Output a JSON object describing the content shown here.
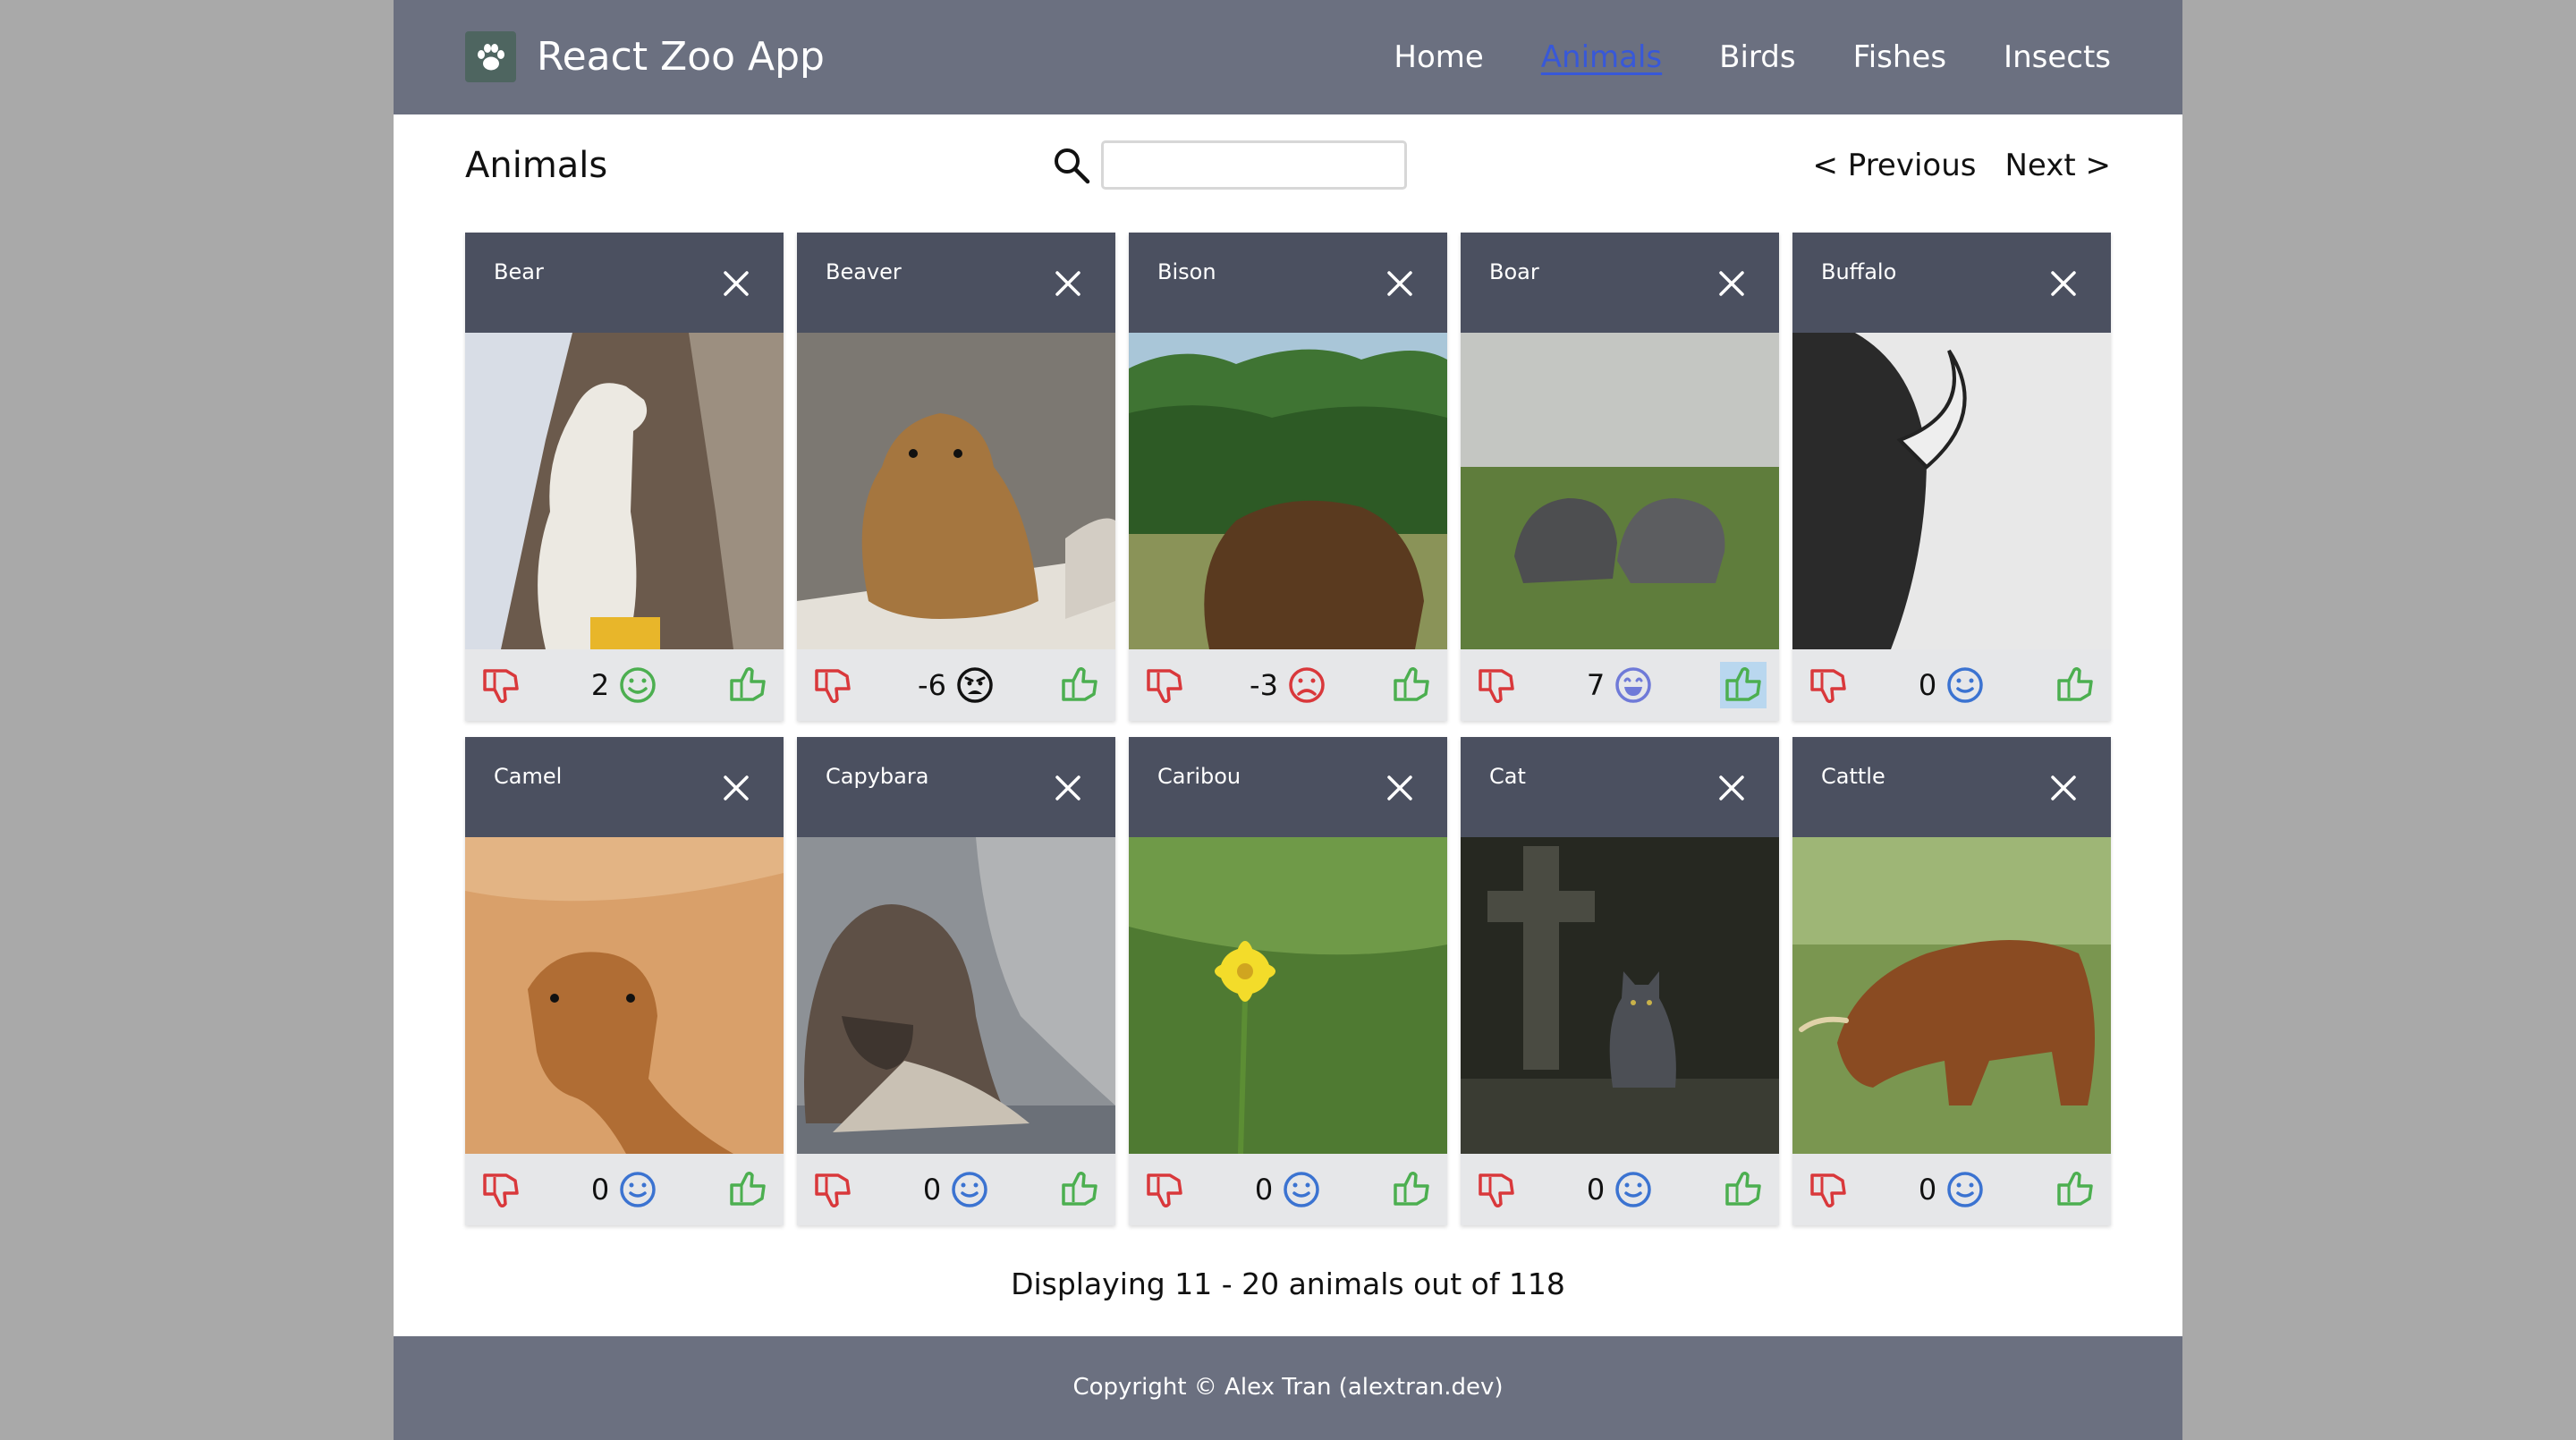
{
  "app": {
    "title": "React Zoo App",
    "logo_icon": "paw-icon"
  },
  "nav": {
    "items": [
      "Home",
      "Animals",
      "Birds",
      "Fishes",
      "Insects"
    ],
    "active": "Animals"
  },
  "page": {
    "title": "Animals"
  },
  "search": {
    "value": "",
    "placeholder": ""
  },
  "pager": {
    "previous": "< Previous",
    "next": "Next >"
  },
  "cards": [
    {
      "name": "Bear",
      "score": "2",
      "mood": "happy",
      "mood_color": "#4caf50"
    },
    {
      "name": "Beaver",
      "score": "-6",
      "mood": "angry",
      "mood_color": "#111111"
    },
    {
      "name": "Bison",
      "score": "-3",
      "mood": "sad",
      "mood_color": "#d9383b"
    },
    {
      "name": "Boar",
      "score": "7",
      "mood": "grin",
      "mood_color": "#6f7ad8"
    },
    {
      "name": "Buffalo",
      "score": "0",
      "mood": "neutral",
      "mood_color": "#3b73d1"
    },
    {
      "name": "Camel",
      "score": "0",
      "mood": "neutral",
      "mood_color": "#3b73d1"
    },
    {
      "name": "Capybara",
      "score": "0",
      "mood": "neutral",
      "mood_color": "#3b73d1"
    },
    {
      "name": "Caribou",
      "score": "0",
      "mood": "neutral",
      "mood_color": "#3b73d1"
    },
    {
      "name": "Cat",
      "score": "0",
      "mood": "neutral",
      "mood_color": "#3b73d1"
    },
    {
      "name": "Cattle",
      "score": "0",
      "mood": "neutral",
      "mood_color": "#3b73d1"
    }
  ],
  "summary": "Displaying 11 - 20 animals out of 118",
  "footer": {
    "copyright": "Copyright © Alex Tran (alextran.dev)"
  },
  "colors": {
    "header": "#6b7080",
    "card_head": "#4b5060",
    "thumb_down": "#d9383b",
    "thumb_up": "#4caf50",
    "active_link": "#3858d8"
  }
}
